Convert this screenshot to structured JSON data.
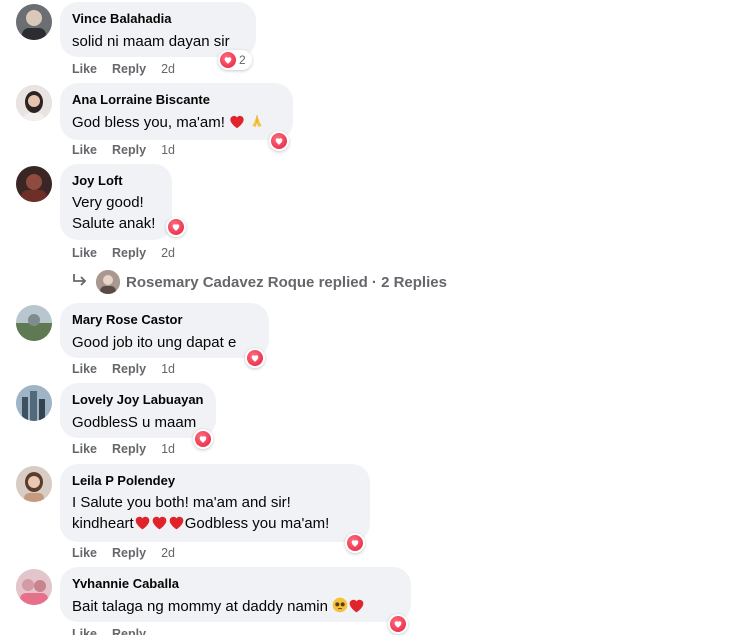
{
  "comments": [
    {
      "author": "Vince Balahadia",
      "lines": [
        "solid ni maam dayan sir"
      ],
      "like": "Like",
      "reply": "Reply",
      "time": "2d",
      "reaction_count": "2"
    },
    {
      "author": "Ana Lorraine Biscante",
      "lines": [
        "God bless you, ma'am!"
      ],
      "like": "Like",
      "reply": "Reply",
      "time": "1d"
    },
    {
      "author": "Joy Loft",
      "lines": [
        "Very good!",
        "Salute anak!"
      ],
      "like": "Like",
      "reply": "Reply",
      "time": "2d"
    },
    {
      "author": "Mary Rose Castor",
      "lines": [
        "Good job ito ung dapat e"
      ],
      "like": "Like",
      "reply": "Reply",
      "time": "1d"
    },
    {
      "author": "Lovely Joy Labuayan",
      "lines": [
        "GodblesS u maam"
      ],
      "like": "Like",
      "reply": "Reply",
      "time": "1d"
    },
    {
      "author": "Leila P Polendey",
      "lines": [
        "I Salute you both! ma'am and sir!",
        "kindheart",
        "Godbless you ma'am!"
      ],
      "like": "Like",
      "reply": "Reply",
      "time": "2d"
    },
    {
      "author": "Yvhannie Caballa",
      "lines": [
        "Bait talaga ng mommy at daddy namin"
      ],
      "like": "Like",
      "reply": "Reply",
      "time": ""
    }
  ],
  "replies_row": {
    "text": "Rosemary Cadavez Roque replied · 2 Replies"
  },
  "icons": {
    "reaction": "heart-icon",
    "reply_arrow": "reply-arrow-icon"
  },
  "colors": {
    "bubble": "#f0f2f5",
    "meta": "#65676b",
    "heart": "#e41e3f"
  }
}
